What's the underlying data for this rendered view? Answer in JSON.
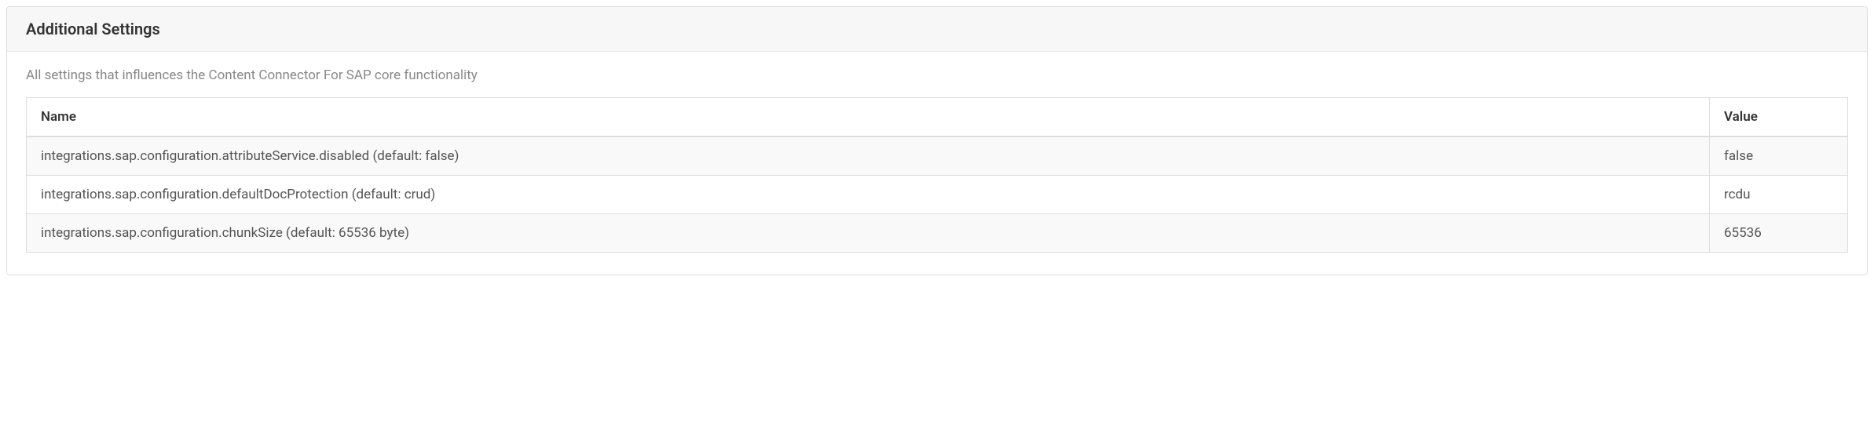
{
  "panel": {
    "title": "Additional Settings",
    "description": "All settings that influences the Content Connector For SAP core functionality"
  },
  "table": {
    "headers": {
      "name": "Name",
      "value": "Value"
    },
    "rows": [
      {
        "name": "integrations.sap.configuration.attributeService.disabled (default: false)",
        "value": "false"
      },
      {
        "name": "integrations.sap.configuration.defaultDocProtection (default: crud)",
        "value": "rcdu"
      },
      {
        "name": "integrations.sap.configuration.chunkSize (default: 65536 byte)",
        "value": "65536"
      }
    ]
  }
}
